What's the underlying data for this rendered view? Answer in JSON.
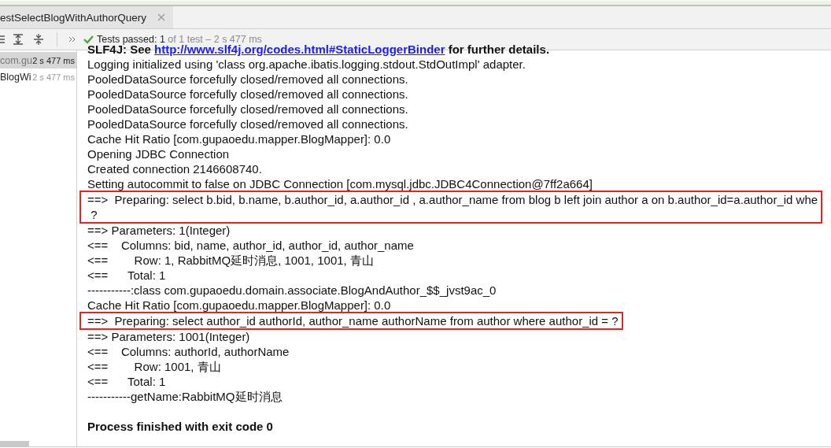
{
  "tab": {
    "title": "estSelectBlogWithAuthorQuery",
    "selected": true
  },
  "toolbar": {
    "label": "Tests passed:",
    "count": "1",
    "total": "of 1 test",
    "separator": "–",
    "time": "2 s 477 ms"
  },
  "test_tree": [
    {
      "name": "com.gu",
      "time": "2 s 477 ms",
      "selected": true
    },
    {
      "name": "BlogWi",
      "time": "2 s 477 ms",
      "selected": false
    }
  ],
  "console": [
    {
      "kind": "link",
      "before": "SLF4J: See ",
      "link": "http://www.slf4j.org/codes.html#StaticLoggerBinder",
      "after": " for further details.",
      "boxed": false
    },
    {
      "kind": "plain",
      "text": "Logging initialized using 'class org.apache.ibatis.logging.stdout.StdOutImpl' adapter.",
      "boxed": false
    },
    {
      "kind": "plain",
      "text": "PooledDataSource forcefully closed/removed all connections.",
      "boxed": false
    },
    {
      "kind": "plain",
      "text": "PooledDataSource forcefully closed/removed all connections.",
      "boxed": false
    },
    {
      "kind": "plain",
      "text": "PooledDataSource forcefully closed/removed all connections.",
      "boxed": false
    },
    {
      "kind": "plain",
      "text": "PooledDataSource forcefully closed/removed all connections.",
      "boxed": false
    },
    {
      "kind": "plain",
      "text": "Cache Hit Ratio [com.gupaoedu.mapper.BlogMapper]: 0.0",
      "boxed": false
    },
    {
      "kind": "plain",
      "text": "Opening JDBC Connection",
      "boxed": false
    },
    {
      "kind": "plain",
      "text": "Created connection 2146608740.",
      "boxed": false
    },
    {
      "kind": "plain",
      "text": "Setting autocommit to false on JDBC Connection [com.mysql.jdbc.JDBC4Connection@7ff2a664]",
      "boxed": false
    },
    {
      "kind": "plain",
      "text": "==>  Preparing: select b.bid, b.name, b.author_id, a.author_id , a.author_name from blog b left join author a on b.author_id=a.author_id whe",
      "boxed": true
    },
    {
      "kind": "plain",
      "text": " ?",
      "boxed": true
    },
    {
      "kind": "plain",
      "text": "==> Parameters: 1(Integer)",
      "boxed": false
    },
    {
      "kind": "plain",
      "text": "<==    Columns: bid, name, author_id, author_id, author_name",
      "boxed": false
    },
    {
      "kind": "plain",
      "text": "<==        Row: 1, RabbitMQ延时消息, 1001, 1001, 青山",
      "boxed": false
    },
    {
      "kind": "plain",
      "text": "<==      Total: 1",
      "boxed": false
    },
    {
      "kind": "plain",
      "text": "-----------:class com.gupaoedu.domain.associate.BlogAndAuthor_$$_jvst9ac_0",
      "boxed": false
    },
    {
      "kind": "plain",
      "text": "Cache Hit Ratio [com.gupaoedu.mapper.BlogMapper]: 0.0",
      "boxed": false
    },
    {
      "kind": "plain",
      "text": "==>  Preparing: select author_id authorId, author_name authorName from author where author_id = ?",
      "boxed": true
    },
    {
      "kind": "plain",
      "text": "==> Parameters: 1001(Integer)",
      "boxed": false
    },
    {
      "kind": "plain",
      "text": "<==    Columns: authorId, authorName",
      "boxed": false
    },
    {
      "kind": "plain",
      "text": "<==        Row: 1001, 青山",
      "boxed": false
    },
    {
      "kind": "plain",
      "text": "<==      Total: 1",
      "boxed": false
    },
    {
      "kind": "plain",
      "text": "-----------getName:RabbitMQ延时消息",
      "boxed": false
    },
    {
      "kind": "blank",
      "boxed": false
    },
    {
      "kind": "bold",
      "text": "Process finished with exit code 0",
      "boxed": false
    }
  ]
}
